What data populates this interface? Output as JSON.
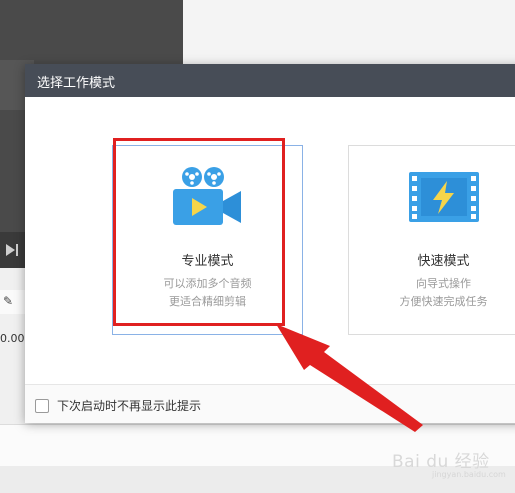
{
  "dialog": {
    "title": "选择工作模式",
    "pro_card": {
      "title": "专业模式",
      "desc_line1": "可以添加多个音频",
      "desc_line2": "更适合精细剪辑",
      "icon": "video-camera-icon"
    },
    "quick_card": {
      "title": "快速模式",
      "desc_line1": "向导式操作",
      "desc_line2": "方便快速完成任务",
      "icon": "film-lightning-icon"
    },
    "footer": {
      "checkbox_label": "下次启动时不再显示此提示",
      "checked": false
    }
  },
  "background": {
    "time_text": "0.00",
    "edit_icon": "pencil-icon",
    "play_icon": "step-forward-icon"
  },
  "watermark": {
    "text": "Bai du 经验",
    "sub": "jingyan.baidu.com"
  },
  "colors": {
    "header_bg": "#474d57",
    "selected_border": "#8ab2e6",
    "annotation_red": "#e02020",
    "icon_blue": "#3aa0e6"
  }
}
